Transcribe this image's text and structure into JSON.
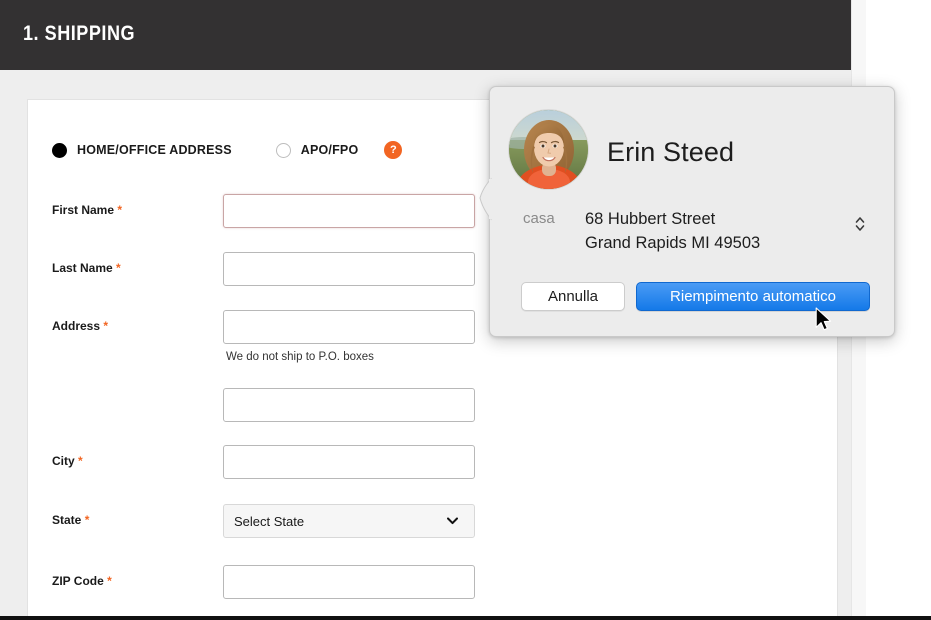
{
  "section": {
    "header_title": "1. SHIPPING"
  },
  "address_type": {
    "options": [
      {
        "label": "HOME/OFFICE ADDRESS",
        "selected": true
      },
      {
        "label": "APO/FPO",
        "selected": false
      }
    ],
    "help_icon": "question-mark-icon",
    "help_glyph": "?"
  },
  "form": {
    "required_marker": "*",
    "fields": [
      {
        "label": "First Name",
        "required": true,
        "value": "",
        "placeholder": "",
        "focused": true
      },
      {
        "label": "Last Name",
        "required": true,
        "value": "",
        "placeholder": "",
        "focused": false
      },
      {
        "label": "Address",
        "required": true,
        "value": "",
        "placeholder": "",
        "focused": false
      },
      {
        "label": "",
        "required": false,
        "value": "",
        "placeholder": "",
        "focused": false
      },
      {
        "label": "City",
        "required": true,
        "value": "",
        "placeholder": "",
        "focused": false
      },
      {
        "label": "ZIP Code",
        "required": true,
        "value": "",
        "placeholder": "",
        "focused": false
      }
    ],
    "address_hint": "We do not ship to P.O. boxes",
    "state": {
      "label": "State",
      "required": true,
      "selected": "Select State",
      "caret_icon": "chevron-down-icon"
    }
  },
  "autofill_popover": {
    "contact_name": "Erin Steed",
    "avatar_icon": "contact-photo",
    "address_kind": "casa",
    "address_line1": "68 Hubbert Street",
    "address_line2": "Grand Rapids MI 49503",
    "stepper_icon": "up-down-chevron-icon",
    "cancel_label": "Annulla",
    "autofill_label": "Riempimento automatico"
  },
  "cursor": {
    "icon": "arrow-pointer-icon"
  },
  "colors": {
    "header_bg": "#333132",
    "page_bg": "#eeeeee",
    "card_bg": "#ffffff",
    "accent_orange": "#f26522",
    "primary_blue": "#1479e8",
    "popover_bg": "#ececec"
  }
}
